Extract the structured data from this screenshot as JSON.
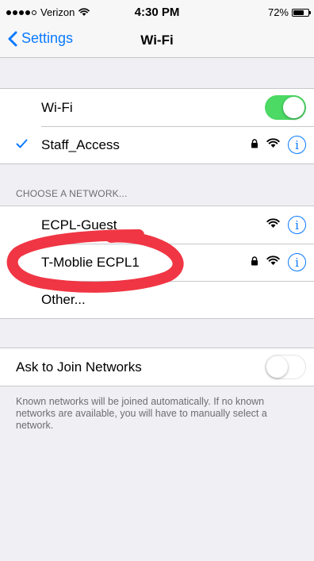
{
  "status_bar": {
    "signal_dots_filled": 4,
    "signal_dots_total": 5,
    "carrier": "Verizon",
    "time": "4:30 PM",
    "battery_percent_text": "72%",
    "battery_level": 0.72
  },
  "nav": {
    "back_label": "Settings",
    "title": "Wi-Fi"
  },
  "wifi_group": {
    "toggle_label": "Wi-Fi",
    "wifi_enabled": true,
    "connected_network": "Staff_Access",
    "connected_secured": true
  },
  "networks_section": {
    "header": "CHOOSE A NETWORK...",
    "networks": [
      {
        "name": "ECPL-Guest",
        "secured": false
      },
      {
        "name": "T-Moblie ECPL1",
        "secured": true
      }
    ],
    "other_label": "Other..."
  },
  "ask_to_join": {
    "label": "Ask to Join Networks",
    "enabled": false,
    "note": "Known networks will be joined automatically. If no known networks are available, you will have to manually select a network."
  },
  "colors": {
    "accent": "#0a7aff",
    "toggle_on": "#4cd964",
    "annotation": "#ef2b3a",
    "background": "#efeff4"
  },
  "icons": {
    "back": "chevron-left-icon",
    "check": "checkmark-icon",
    "lock": "lock-icon",
    "wifi": "wifi-icon",
    "info": "info-icon"
  }
}
